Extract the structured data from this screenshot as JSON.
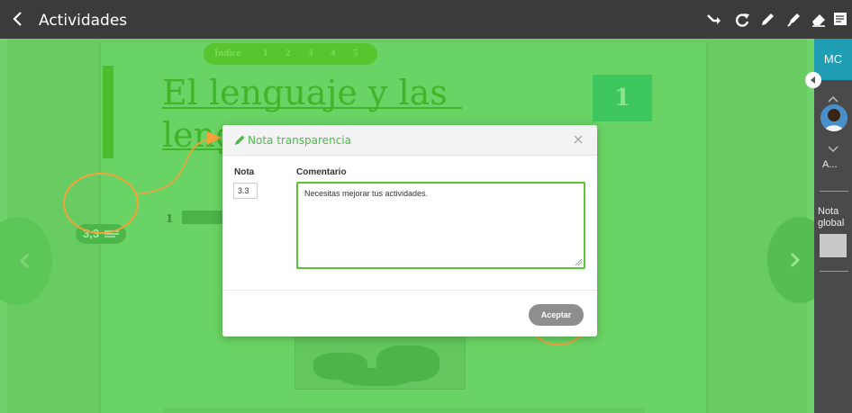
{
  "topbar": {
    "title": "Actividades",
    "tools": [
      "share-arrow-icon",
      "redo-icon",
      "pencil-icon",
      "marker-icon",
      "eraser-icon",
      "notes-icon"
    ]
  },
  "book": {
    "index_label": "Índice",
    "index_pages": [
      "1",
      "2",
      "3",
      "4",
      "5"
    ],
    "title_line1": "El lenguaje y las",
    "title_line2": "leng",
    "unit_number": "1",
    "item_number": "1",
    "grade_badge": "3,3"
  },
  "modal": {
    "title": "Nota transparencia",
    "grade_label": "Nota",
    "comment_label": "Comentario",
    "grade_value": "3.3",
    "comment_value": "Necesitas mejorar tus actividades.",
    "accept_label": "Aceptar"
  },
  "rail": {
    "initials": "MC",
    "student_name": "A...",
    "global_grade_label_1": "Nota",
    "global_grade_label_2": "global"
  },
  "colors": {
    "overlay_green": "#6fd26a",
    "accent_green": "#4db84b",
    "highlight_orange": "#f4a23a",
    "rail_teal": "#1f9db2"
  }
}
